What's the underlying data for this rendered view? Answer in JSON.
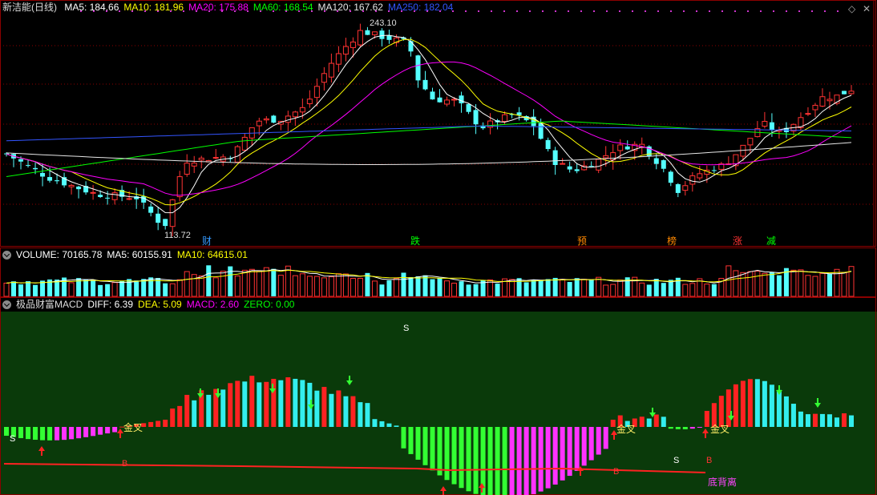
{
  "price_panel": {
    "title": "新洁能(日线)",
    "ma": [
      {
        "label": "MA5: 184.66",
        "color": "#ffffff"
      },
      {
        "label": "MA10: 181.96",
        "color": "#ffff00"
      },
      {
        "label": "MA20: 175.88",
        "color": "#ff00ff"
      },
      {
        "label": "MA60: 168.54",
        "color": "#00ff00"
      },
      {
        "label": "MA120: 167.62",
        "color": "#e6e6e6"
      },
      {
        "label": "MA250: 182.04",
        "color": "#3355ff"
      }
    ],
    "high_label": "243.10",
    "low_label": "113.72",
    "events": [
      {
        "text": "财",
        "color": "#3399ff"
      },
      {
        "text": "跌",
        "color": "#00ff00"
      },
      {
        "text": "预",
        "color": "#ff8800"
      },
      {
        "text": "榜",
        "color": "#ff8800"
      },
      {
        "text": "涨",
        "color": "#ff3333"
      },
      {
        "text": "减",
        "color": "#00ff00"
      }
    ]
  },
  "volume_panel": {
    "items": [
      {
        "label": "VOLUME: 70165.78",
        "color": "#ffffff"
      },
      {
        "label": "MA5: 60155.91",
        "color": "#ffffff"
      },
      {
        "label": "MA10: 64615.01",
        "color": "#ffff00"
      }
    ]
  },
  "macd_panel": {
    "title": "极品财富MACD",
    "items": [
      {
        "label": "DIFF: 6.39",
        "color": "#ffffff"
      },
      {
        "label": "DEA: 5.09",
        "color": "#ffff00"
      },
      {
        "label": "MACD: 2.60",
        "color": "#ff00ff"
      },
      {
        "label": "ZERO: 0.00",
        "color": "#00ff00"
      }
    ],
    "signals": {
      "s": "S",
      "b": "B",
      "golden_cross": "金叉",
      "divergence": "底背离"
    }
  },
  "controls": {
    "diamond": "◇",
    "close": "✕"
  }
}
